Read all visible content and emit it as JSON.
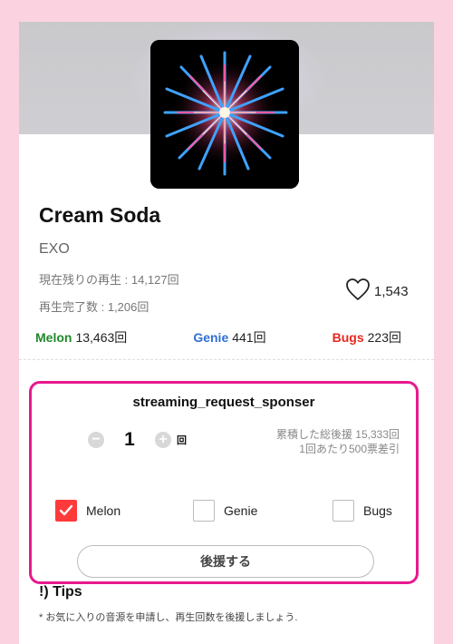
{
  "song": {
    "title": "Cream Soda",
    "artist": "EXO",
    "remaining_plays": "現在残りの再生 : 14,127回",
    "completed_plays": "再生完了数 : 1,206回",
    "likes": "1,543"
  },
  "platform_stats": [
    {
      "name": "Melon",
      "count": "13,463回",
      "color": "#1e8a2a"
    },
    {
      "name": "Genie",
      "count": "441回",
      "color": "#2e6fd8"
    },
    {
      "name": "Bugs",
      "count": "223回",
      "color": "#e8281f"
    }
  ],
  "sponsor": {
    "title": "streaming_request_sponser",
    "quantity": "1",
    "unit": "回",
    "minus_label": "−",
    "plus_label": "+",
    "total_support": "累積した総後援 15,333回",
    "deduction": "1回あたり500票差引",
    "options": [
      {
        "label": "Melon",
        "checked": true
      },
      {
        "label": "Genie",
        "checked": false
      },
      {
        "label": "Bugs",
        "checked": false
      }
    ],
    "button_label": "後援する"
  },
  "tips": {
    "title": "!) Tips",
    "text": "* お気に入りの音源を申請し、再生回数を後援しましょう."
  },
  "colors": {
    "page_bg": "#fbd3e0",
    "accent_border": "#e7198f",
    "checked_box": "#ff3a3a"
  }
}
